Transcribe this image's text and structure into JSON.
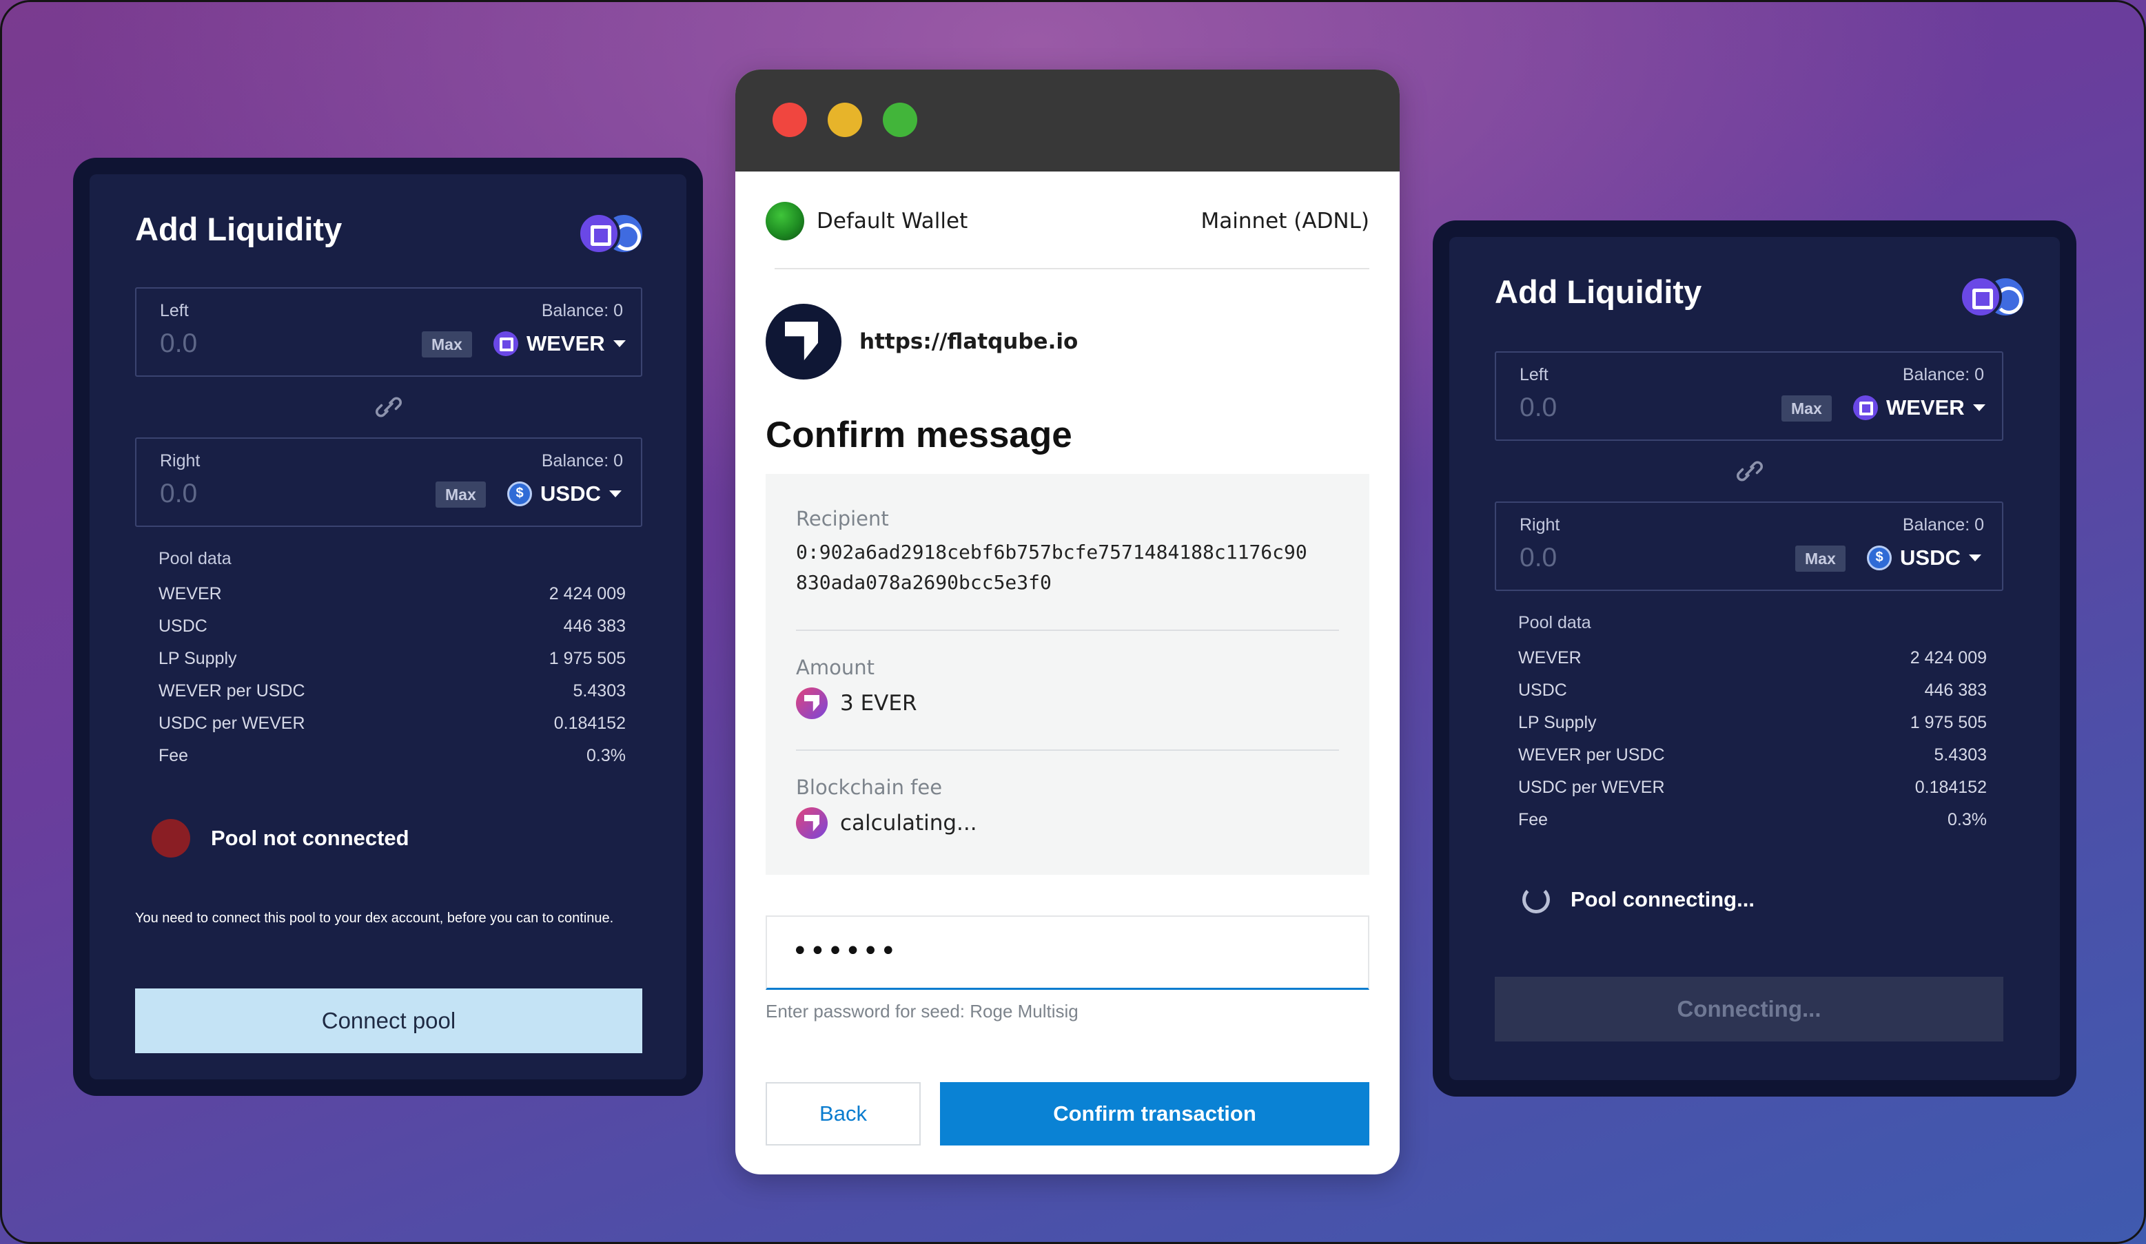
{
  "left_panel": {
    "title": "Add Liquidity",
    "pair_icon": "wever-usdc-pair-icon",
    "left_field": {
      "label": "Left",
      "balance": "Balance: 0",
      "value": "0.0",
      "max_label": "Max",
      "token": "WEVER"
    },
    "right_field": {
      "label": "Right",
      "balance": "Balance: 0",
      "value": "0.0",
      "max_label": "Max",
      "token": "USDC"
    },
    "pool_header": "Pool data",
    "pool_rows": [
      {
        "k": "WEVER",
        "v": "2 424 009"
      },
      {
        "k": "USDC",
        "v": "446 383"
      },
      {
        "k": "LP Supply",
        "v": "1 975 505"
      },
      {
        "k": "WEVER per USDC",
        "v": "5.4303"
      },
      {
        "k": "USDC per WEVER",
        "v": "0.184152"
      },
      {
        "k": "Fee",
        "v": "0.3%"
      }
    ],
    "status": "Pool not connected",
    "status_color": "#8a1e24",
    "note": "You need to connect this pool to your dex account, before you can to continue.",
    "button": "Connect pool"
  },
  "right_panel": {
    "title": "Add Liquidity",
    "left_field": {
      "label": "Left",
      "balance": "Balance: 0",
      "value": "0.0",
      "max_label": "Max",
      "token": "WEVER"
    },
    "right_field": {
      "label": "Right",
      "balance": "Balance: 0",
      "value": "0.0",
      "max_label": "Max",
      "token": "USDC"
    },
    "pool_header": "Pool data",
    "pool_rows": [
      {
        "k": "WEVER",
        "v": "2 424 009"
      },
      {
        "k": "USDC",
        "v": "446 383"
      },
      {
        "k": "LP Supply",
        "v": "1 975 505"
      },
      {
        "k": "WEVER per USDC",
        "v": "5.4303"
      },
      {
        "k": "USDC per WEVER",
        "v": "0.184152"
      },
      {
        "k": "Fee",
        "v": "0.3%"
      }
    ],
    "status": "Pool connecting...",
    "button": "Connecting..."
  },
  "wallet_window": {
    "traffic_lights": [
      "#f0463f",
      "#e7b42a",
      "#42b53a"
    ],
    "wallet_name": "Default Wallet",
    "network": "Mainnet (ADNL)",
    "site": "https://flatqube.io",
    "title": "Confirm message",
    "recipient_label": "Recipient",
    "recipient_line1": "0:902a6ad2918cebf6b757bcfe7571484188c1176c90",
    "recipient_line2": "830ada078a2690bcc5e3f0",
    "amount_label": "Amount",
    "amount": "3 EVER",
    "fee_label": "Blockchain fee",
    "fee": "calculating...",
    "password_value": "••••••",
    "password_hint": "Enter password for seed: Roge Multisig",
    "back_button": "Back",
    "confirm_button": "Confirm transaction",
    "accent": "#0a82d4"
  }
}
